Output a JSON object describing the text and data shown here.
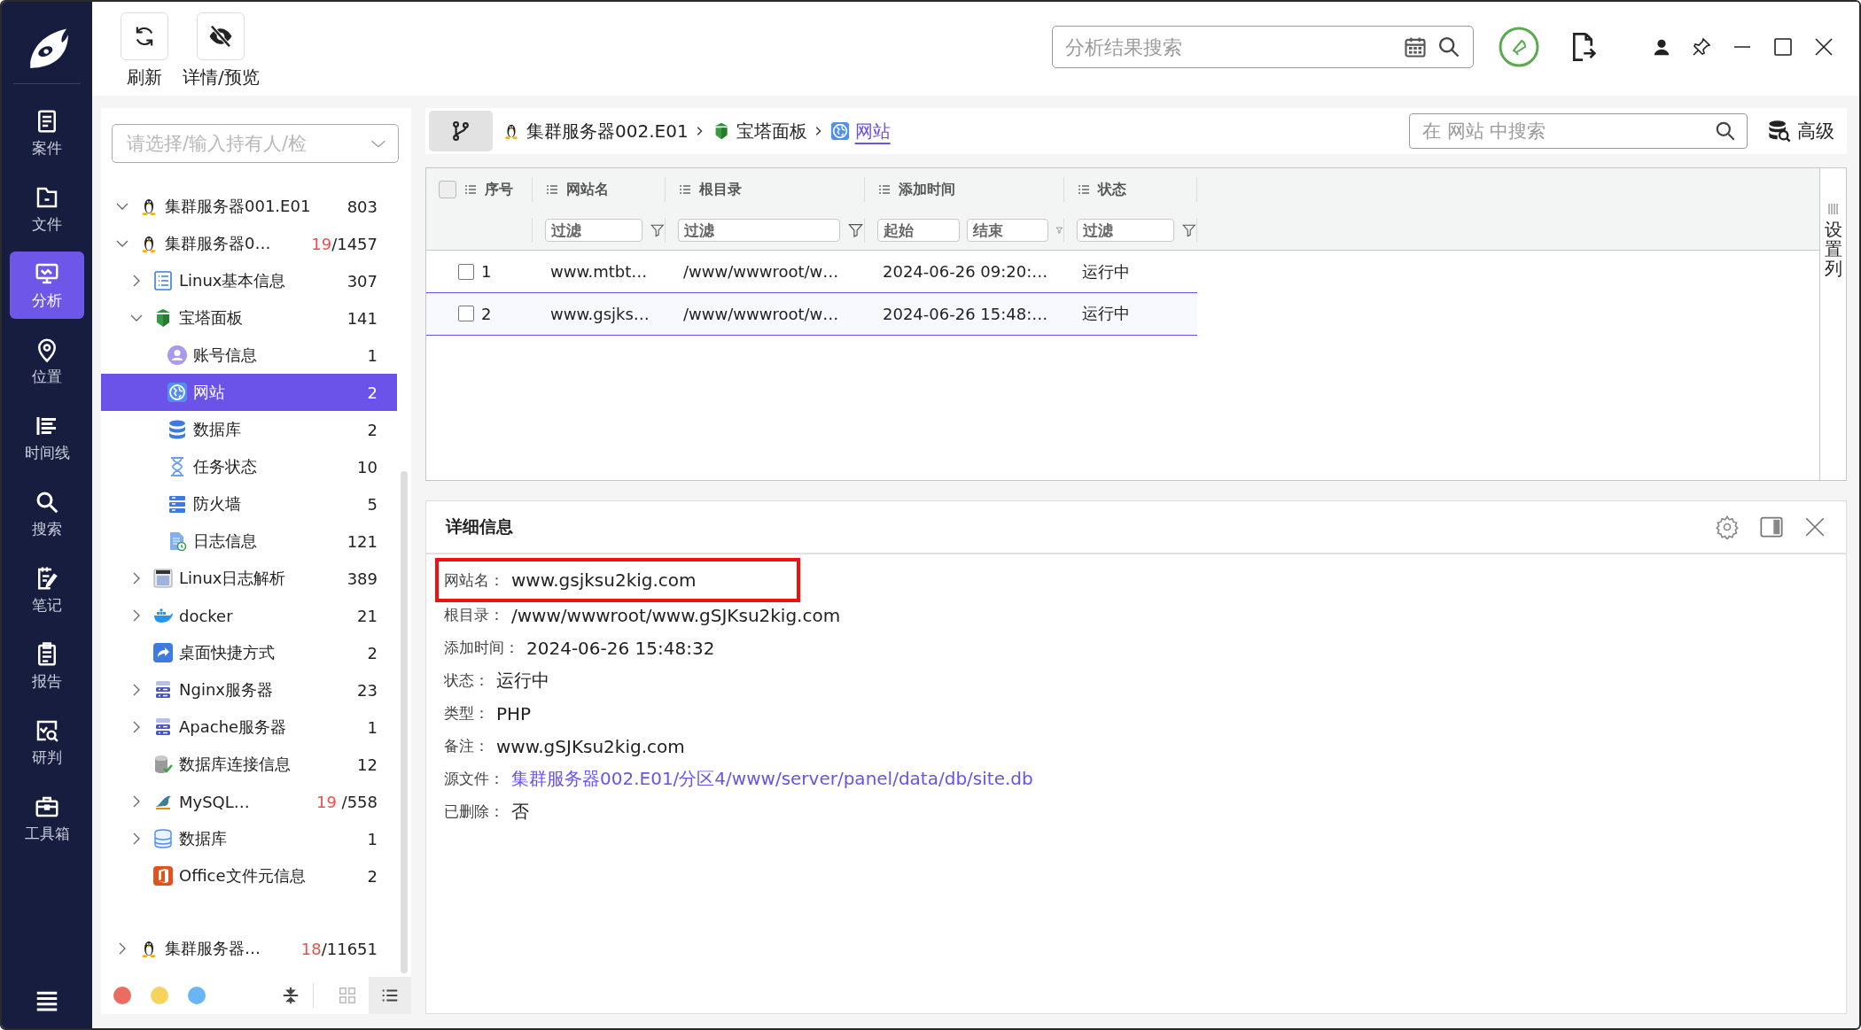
{
  "nav": {
    "items": [
      {
        "label": "案件",
        "kind": "case",
        "selected": false
      },
      {
        "label": "文件",
        "kind": "file",
        "selected": false
      },
      {
        "label": "分析",
        "kind": "analysis",
        "selected": true
      },
      {
        "label": "位置",
        "kind": "location",
        "selected": false
      },
      {
        "label": "时间线",
        "kind": "timeline",
        "selected": false
      },
      {
        "label": "搜索",
        "kind": "search",
        "selected": false
      },
      {
        "label": "笔记",
        "kind": "notes",
        "selected": false
      },
      {
        "label": "报告",
        "kind": "report",
        "selected": false
      },
      {
        "label": "研判",
        "kind": "judge",
        "selected": false
      },
      {
        "label": "工具箱",
        "kind": "toolbox",
        "selected": false
      }
    ]
  },
  "toolbar": {
    "buttons": [
      {
        "label": "刷新",
        "kind": "refresh"
      },
      {
        "label": "详情/预览",
        "kind": "hide"
      }
    ],
    "search": {
      "placeholder": "分析结果搜索"
    }
  },
  "tree": {
    "selector": {
      "placeholder": "请选择/输入持有人/检"
    },
    "items": [
      {
        "label": "集群服务器001.E01",
        "kind": "linux",
        "count": "803",
        "expanded": true,
        "selected": false
      },
      {
        "label": "集群服务器0…",
        "kind": "linux",
        "alert": "19",
        "count": "/1457",
        "expanded": true,
        "selected": false,
        "children": [
          {
            "label": "Linux基本信息",
            "kind": "list",
            "count": "307",
            "expanded": false,
            "selected": false
          },
          {
            "label": "宝塔面板",
            "kind": "baota",
            "count": "141",
            "expanded": true,
            "selected": false,
            "children": [
              {
                "label": "账号信息",
                "kind": "user",
                "count": "1",
                "selected": false
              },
              {
                "label": "网站",
                "kind": "globe",
                "count": "2",
                "selected": true
              },
              {
                "label": "数据库",
                "kind": "db",
                "count": "2",
                "selected": false
              },
              {
                "label": "任务状态",
                "kind": "hourglass",
                "count": "10",
                "selected": false
              },
              {
                "label": "防火墙",
                "kind": "firewall",
                "count": "5",
                "selected": false
              },
              {
                "label": "日志信息",
                "kind": "logfile",
                "count": "121",
                "selected": false
              }
            ]
          },
          {
            "label": "Linux日志解析",
            "kind": "log",
            "count": "389",
            "expanded": false,
            "selected": false
          },
          {
            "label": "docker",
            "kind": "docker",
            "count": "21",
            "expanded": false,
            "selected": false
          },
          {
            "label": "桌面快捷方式",
            "kind": "shortcut",
            "count": "2",
            "selected": false
          },
          {
            "label": "Nginx服务器",
            "kind": "server",
            "count": "23",
            "expanded": false,
            "selected": false
          },
          {
            "label": "Apache服务器",
            "kind": "server",
            "count": "1",
            "expanded": false,
            "selected": false
          },
          {
            "label": "数据库连接信息",
            "kind": "dbconn",
            "count": "12",
            "selected": false
          },
          {
            "label": "MySQL…",
            "kind": "mysql",
            "alert": "19",
            "count": " /558",
            "expanded": false,
            "selected": false
          },
          {
            "label": "数据库",
            "kind": "database",
            "count": "1",
            "expanded": false,
            "selected": false
          },
          {
            "label": "Office文件元信息",
            "kind": "office",
            "count": "2",
            "selected": false
          }
        ]
      },
      {
        "label": "集群服务器…",
        "kind": "linux",
        "alert": "18",
        "count": "/11651",
        "expanded": false,
        "selected": false
      }
    ],
    "dots": [
      {
        "color": "#ec6c5f"
      },
      {
        "color": "#f6d35f"
      },
      {
        "color": "#6ab5f5"
      }
    ],
    "views": [
      {
        "kind": "grid",
        "selected": false
      },
      {
        "kind": "list",
        "selected": true
      }
    ]
  },
  "breadcrumb": [
    {
      "label": "集群服务器002.E01",
      "kind": "linux",
      "current": false
    },
    {
      "label": "宝塔面板",
      "kind": "baota",
      "current": false
    },
    {
      "label": "网站",
      "kind": "globe",
      "current": true
    }
  ],
  "panel_search": {
    "placeholder": "在 网站 中搜索"
  },
  "advanced": {
    "label": "高级"
  },
  "table": {
    "columns": [
      {
        "label": "序号"
      },
      {
        "label": "网站名",
        "placeholders": [
          "过滤"
        ]
      },
      {
        "label": "根目录",
        "placeholders": [
          "过滤"
        ]
      },
      {
        "label": "添加时间",
        "placeholders": [
          "起始",
          "结束"
        ]
      },
      {
        "label": "状态",
        "placeholders": [
          "过滤"
        ]
      }
    ],
    "all_checked": false,
    "rows": [
      {
        "checked": false,
        "selected": false,
        "cells": [
          "1",
          "www.mtbt…",
          "/www/wwwroot/w…",
          "2024-06-26 09:20:…",
          "运行中"
        ]
      },
      {
        "checked": false,
        "selected": true,
        "cells": [
          "2",
          "www.gsjks…",
          "/www/wwwroot/w…",
          "2024-06-26 15:48:…",
          "运行中"
        ]
      }
    ],
    "column_settings": "设置列"
  },
  "detail": {
    "title": "详细信息",
    "fields": [
      {
        "label": "网站名：",
        "value": "www.gsjksu2kig.com",
        "kind": "text",
        "highlighted": true
      },
      {
        "label": "根目录：",
        "value": "/www/wwwroot/www.gSJKsu2kig.com",
        "kind": "text",
        "highlighted": false
      },
      {
        "label": "添加时间：",
        "value": "2024-06-26 15:48:32",
        "kind": "text",
        "highlighted": false
      },
      {
        "label": "状态：",
        "value": "运行中",
        "kind": "text",
        "highlighted": false
      },
      {
        "label": "类型：",
        "value": "PHP",
        "kind": "text",
        "highlighted": false
      },
      {
        "label": "备注：",
        "value": "www.gSJKsu2kig.com",
        "kind": "text",
        "highlighted": false
      },
      {
        "label": "源文件：",
        "value": "集群服务器002.E01/分区4/www/server/panel/data/db/site.db",
        "kind": "link",
        "highlighted": false
      },
      {
        "label": "已删除：",
        "value": "否",
        "kind": "text",
        "highlighted": false
      }
    ]
  }
}
